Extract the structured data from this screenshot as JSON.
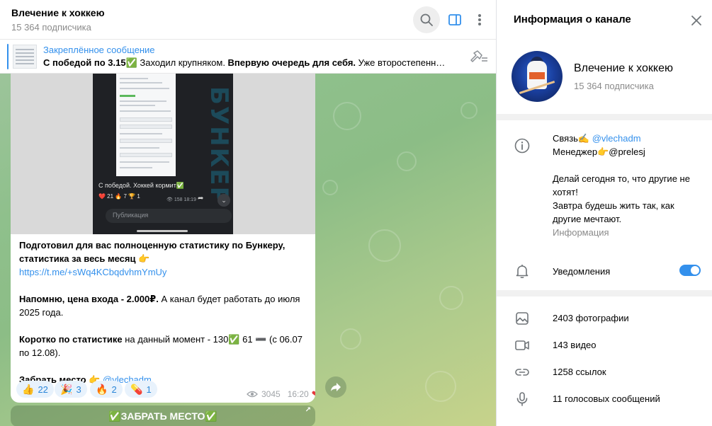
{
  "chat": {
    "title": "Влечение к хоккею",
    "subscribers": "15 364 подписчика",
    "pinned": {
      "title": "Закреплённое сообщение",
      "text_bold_1": "С победой по 3.15✅",
      "text_normal_1": " Заходил крупняком. ",
      "text_bold_2": "Впервую очередь для себя.",
      "text_normal_2": " Уже второстепенн…"
    }
  },
  "message": {
    "screenshot": {
      "brand_vertical": "БУНКЕР",
      "caption": "С победой. Хоккей кормит✅",
      "reactions": "❤️ 21   🔥 7   🏆 1",
      "time": "👁 158  18:19",
      "input_placeholder": "Публикация"
    },
    "p1_bold": "Подготовил для вас полноценную статистику по Бункеру, статистика за весь месяц 👉",
    "p1_link": "https://t.me/+sWq4KCbqdvhmYmUy",
    "p2_bold": "Напомню, цена входа - 2.000₽.",
    "p2_normal": " А канал будет работать до июля 2025 года.",
    "p3_bold": "Коротко по статистике",
    "p3_normal": " на данный момент - 130✅ 61 ➖ (с 06.07 по 12.08).",
    "p4_bold": "Забрать место 👉",
    "p4_link": " @vlechadm",
    "reactions": [
      {
        "emoji": "👍",
        "count": "22"
      },
      {
        "emoji": "🎉",
        "count": "3"
      },
      {
        "emoji": "🔥",
        "count": "2"
      },
      {
        "emoji": "💊",
        "count": "1"
      }
    ],
    "views": "3045",
    "time": "16:20",
    "button_label": "✅ЗАБРАТЬ МЕСТО✅"
  },
  "info": {
    "header_title": "Информация о канале",
    "name": "Влечение к хоккею",
    "subscribers": "15 364 подписчика",
    "desc_line1_text": "Связь✍️",
    "desc_line1_link": " @vlechadm",
    "desc_line2": "Менеджер👉@prelesj",
    "desc_line3": "Делай сегодня то, что другие не хотят!",
    "desc_line4": "Завтра будешь жить так, как другие мечтают.",
    "desc_label": "Информация",
    "notifications_label": "Уведомления",
    "notifications_on": true,
    "media": [
      {
        "icon": "photo-icon",
        "label": "2403 фотографии"
      },
      {
        "icon": "video-icon",
        "label": "143 видео"
      },
      {
        "icon": "link-icon",
        "label": "1258 ссылок"
      },
      {
        "icon": "mic-icon",
        "label": "11 голосовых сообщений"
      }
    ]
  },
  "colors": {
    "accent": "#3390ec",
    "chat_bg_top": "#8fc08c",
    "chat_bg_bottom": "#c7d38b",
    "reaction_bg": "#e8f2fc"
  }
}
